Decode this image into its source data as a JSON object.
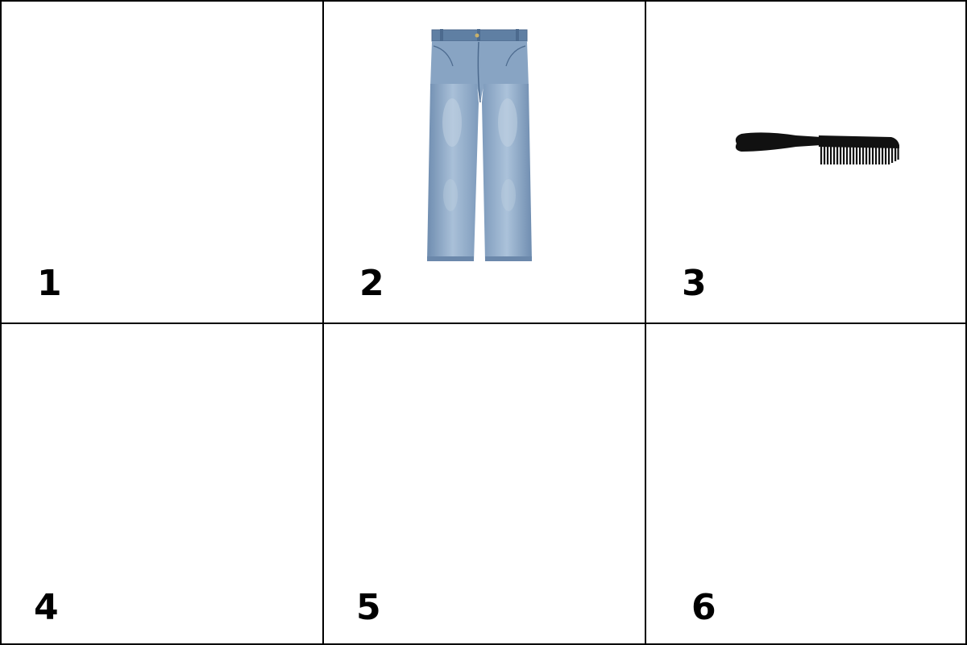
{
  "cells": [
    {
      "number": "1",
      "item": "empty"
    },
    {
      "number": "2",
      "item": "jeans"
    },
    {
      "number": "3",
      "item": "comb"
    },
    {
      "number": "4",
      "item": "empty"
    },
    {
      "number": "5",
      "item": "empty"
    },
    {
      "number": "6",
      "item": "empty"
    }
  ],
  "colors": {
    "border": "#000000",
    "background": "#ffffff",
    "denim_light": "#9fb6cf",
    "denim_mid": "#7f9cbd",
    "denim_dark": "#5f7fa3",
    "comb": "#111111"
  }
}
